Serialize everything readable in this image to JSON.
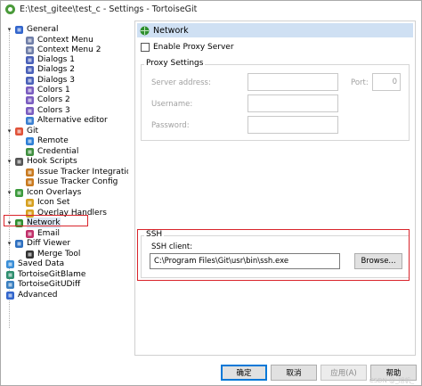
{
  "window": {
    "title": "E:\\test_gitee\\test_c - Settings - TortoiseGit"
  },
  "tree": {
    "items": [
      {
        "label": "General",
        "icon": "wrench-icon",
        "expander": "▾"
      },
      {
        "label": "Context Menu",
        "icon": "context-menu-icon"
      },
      {
        "label": "Context Menu 2",
        "icon": "context-menu-icon"
      },
      {
        "label": "Dialogs 1",
        "icon": "dialog-icon"
      },
      {
        "label": "Dialogs 2",
        "icon": "dialog-icon"
      },
      {
        "label": "Dialogs 3",
        "icon": "dialog-icon"
      },
      {
        "label": "Colors 1",
        "icon": "colors-icon"
      },
      {
        "label": "Colors 2",
        "icon": "colors-icon"
      },
      {
        "label": "Colors 3",
        "icon": "colors-icon"
      },
      {
        "label": "Alternative editor",
        "icon": "editor-icon"
      },
      {
        "label": "Git",
        "icon": "git-icon",
        "expander": "▾"
      },
      {
        "label": "Remote",
        "icon": "remote-icon"
      },
      {
        "label": "Credential",
        "icon": "credential-icon"
      },
      {
        "label": "Hook Scripts",
        "icon": "hook-icon",
        "expander": "▾"
      },
      {
        "label": "Issue Tracker Integration",
        "icon": "bug-icon"
      },
      {
        "label": "Issue Tracker Config",
        "icon": "bug-icon"
      },
      {
        "label": "Icon Overlays",
        "icon": "overlay-icon",
        "expander": "▾"
      },
      {
        "label": "Icon Set",
        "icon": "icon-set-icon"
      },
      {
        "label": "Overlay Handlers",
        "icon": "overlay-handler-icon"
      },
      {
        "label": "Network",
        "icon": "network-icon",
        "expander": "▾"
      },
      {
        "label": "Email",
        "icon": "email-icon"
      },
      {
        "label": "Diff Viewer",
        "icon": "diff-icon",
        "expander": "▾"
      },
      {
        "label": "Merge Tool",
        "icon": "merge-icon"
      },
      {
        "label": "Saved Data",
        "icon": "saved-data-icon"
      },
      {
        "label": "TortoiseGitBlame",
        "icon": "blame-icon"
      },
      {
        "label": "TortoiseGitUDiff",
        "icon": "udiff-icon"
      },
      {
        "label": "Advanced",
        "icon": "wrench-icon"
      }
    ]
  },
  "panel": {
    "header": "Network",
    "enable_proxy_label": "Enable Proxy Server",
    "proxy_group_title": "Proxy Settings",
    "server_address_label": "Server address:",
    "port_label": "Port:",
    "port_value": "0",
    "username_label": "Username:",
    "password_label": "Password:",
    "ssh_group_title": "SSH",
    "ssh_client_label": "SSH client:",
    "ssh_client_value": "C:\\Program Files\\Git\\usr\\bin\\ssh.exe",
    "browse_label": "Browse..."
  },
  "buttons": {
    "ok": "确定",
    "cancel": "取消",
    "apply": "应用(A)",
    "help": "帮助"
  },
  "watermark": "CSDN @_旭帆_",
  "colors": {
    "selection": "#cfe0f3",
    "highlight_red": "#d9242b",
    "accent": "#0078d7"
  }
}
